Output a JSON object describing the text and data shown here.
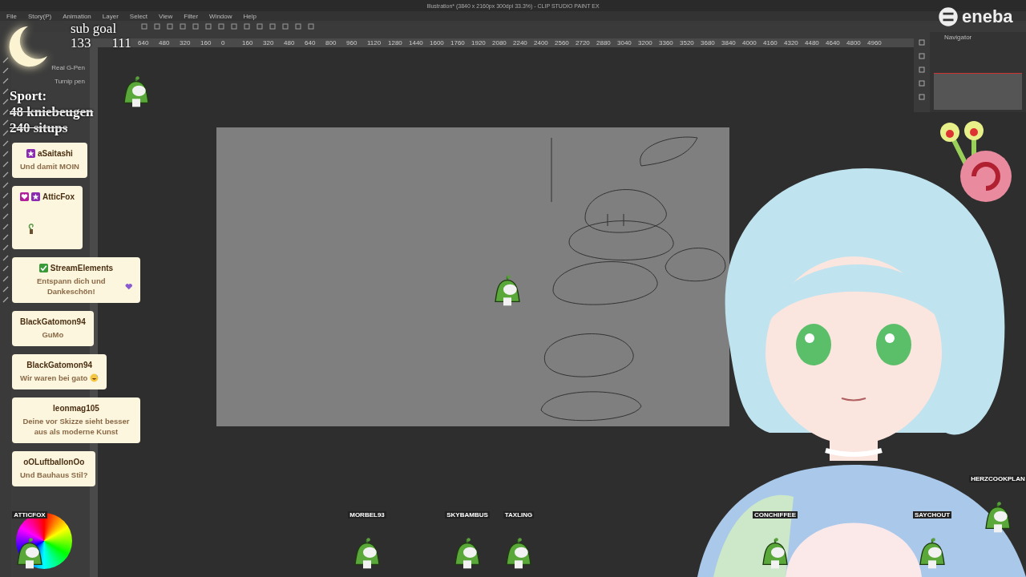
{
  "window": {
    "title": "Illustration* (3840 x 2160px 300dpi 33.3%) - CLIP STUDIO PAINT EX"
  },
  "menu": [
    "File",
    "Story(P)",
    "Animation",
    "Layer",
    "Select",
    "View",
    "Filter",
    "Window",
    "Help"
  ],
  "ruler_labels": [
    "640",
    "480",
    "320",
    "160",
    "0",
    "160",
    "320",
    "480",
    "640",
    "800",
    "960",
    "1120",
    "1280",
    "1440",
    "1600",
    "1760",
    "1920",
    "2080",
    "2240",
    "2400",
    "2560",
    "2720",
    "2880",
    "3040",
    "3200",
    "3360",
    "3520",
    "3680",
    "3840",
    "4000",
    "4160",
    "4320",
    "4480",
    "4640",
    "4800",
    "4960"
  ],
  "sub_tools": [
    "Real G-Pen",
    "Turnip pen"
  ],
  "right_panel": {
    "tab": "Navigator"
  },
  "overlay": {
    "sub_goal": {
      "label": "sub goal",
      "current": "133",
      "target": "111"
    },
    "sport": {
      "title": "Sport:",
      "items": [
        {
          "text": "48 kniebeugen",
          "struck": true
        },
        {
          "text": "240 situps",
          "struck": true
        }
      ]
    }
  },
  "chat": [
    {
      "user": "aSaitashi",
      "badges": [
        {
          "kind": "star",
          "color": "#8a2bb0"
        }
      ],
      "message": "Und damit MOIN"
    },
    {
      "user": "AtticFox",
      "badges": [
        {
          "kind": "heart",
          "color": "#b0209b"
        },
        {
          "kind": "star",
          "color": "#8a2bb0"
        }
      ],
      "emote": true
    },
    {
      "user": "StreamElements",
      "badges": [
        {
          "kind": "check",
          "color": "#3a9a3a"
        }
      ],
      "message": "Entspann dich und Dankeschön!",
      "emoji": {
        "kind": "heart"
      }
    },
    {
      "user": "BlackGatomon94",
      "message": "GuMo"
    },
    {
      "user": "BlackGatomon94",
      "message": "Wir waren bei gato",
      "emoji": {
        "kind": "sweat-smile"
      }
    },
    {
      "user": "leonmag105",
      "message": "Deine vor Skizze sieht besser aus als moderne Kunst"
    },
    {
      "user": "oOLuftballonOo",
      "message": "Und Bauhaus Stil?"
    }
  ],
  "mascots": [
    {
      "kind": "sprout"
    },
    {
      "kind": "sprout"
    },
    {
      "name": "ATTICFOX",
      "kind": "sprout"
    },
    {
      "name": "MORBEL93",
      "kind": "sprout"
    },
    {
      "name": "SKYBAMBUS",
      "kind": "sprout"
    },
    {
      "name": "TAXLING",
      "kind": "sprout"
    },
    {
      "name": "CONCHIFFEE",
      "kind": "sprout"
    },
    {
      "name": "SAYCHOUT",
      "kind": "sprout"
    },
    {
      "name": "HERZCOOKPLAN",
      "kind": "sprout"
    }
  ],
  "logo": {
    "text": "eneba"
  }
}
